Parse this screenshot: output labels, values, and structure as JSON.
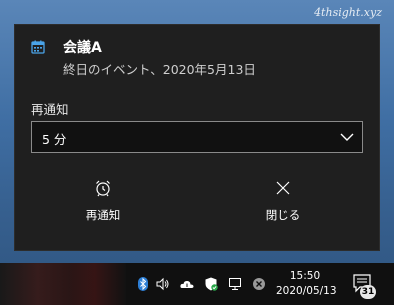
{
  "watermark": "4thsight.xyz",
  "notification": {
    "icon": "calendar-icon",
    "title": "会議A",
    "subtitle": "終日のイベント、2020年5月13日",
    "snooze_label": "再通知",
    "snooze_value": "5 分",
    "buttons": {
      "snooze": "再通知",
      "dismiss": "閉じる"
    }
  },
  "taskbar": {
    "time": "15:50",
    "date": "2020/05/13",
    "notification_count": "31",
    "tray_icons": [
      "bluetooth-icon",
      "volume-icon",
      "onedrive-icon",
      "security-icon",
      "network-icon",
      "close-circle-icon"
    ]
  },
  "colors": {
    "toast_bg": "#1f1f1f",
    "accent": "#4aa3e8",
    "taskbar_bg": "#101010"
  }
}
